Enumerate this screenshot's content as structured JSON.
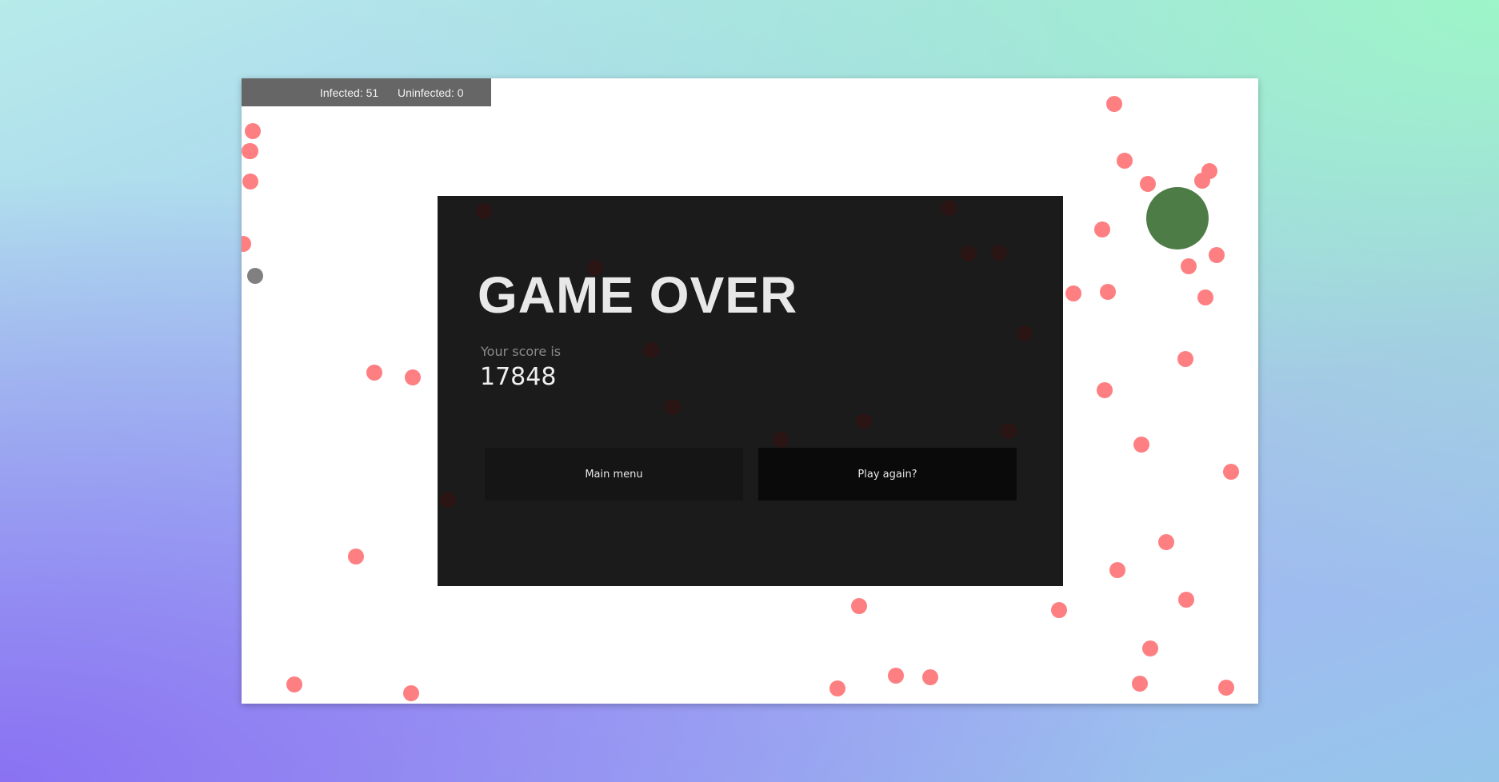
{
  "hud": {
    "infected": "Infected: 51",
    "uninfected": "Uninfected: 0"
  },
  "game_over": {
    "title": "GAME OVER",
    "score_label": "Your score is",
    "score": "17848",
    "main_menu_label": "Main menu",
    "play_again_label": "Play again?"
  },
  "colors": {
    "infected_cell": "#fe7f82",
    "uninfected_cell": "#808080",
    "player_cell": "#4e7c47",
    "panel": "#1b1b1b",
    "hud": "#666666"
  }
}
